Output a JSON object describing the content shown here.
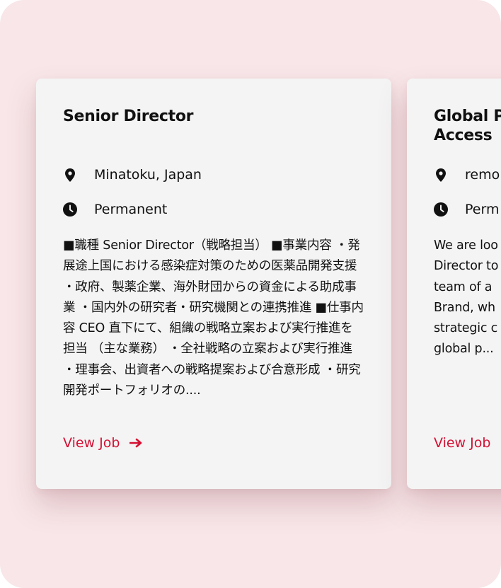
{
  "jobs": [
    {
      "title": "Senior Director",
      "location": "Minatoku, Japan",
      "type": "Permanent",
      "description": "■職種 Senior Director（戦略担当） ■事業内容 ・発展途上国における感染症対策のための医薬品開発支援 ・政府、製薬企業、海外財団からの資金による助成事業 ・国内外の研究者・研究機関との連携推進 ■仕事内容 CEO 直下にて、組織の戦略立案および実行推進を担当 （主な業務） ・全社戦略の立案および実行推進 ・理事会、出資者への戦略提案および合意形成 ・研究開発ポートフォリオの....",
      "link_label": "View Job"
    },
    {
      "title": "Global P\nAccess",
      "location": "remo",
      "type": "Perm",
      "description": "We are loo\nDirector to\nteam of a\nBrand, wh\nstrategic c\nglobal p...",
      "link_label": "View Job"
    }
  ],
  "colors": {
    "background": "#f8e6e8",
    "card": "#f4f4f4",
    "accent": "#d40f33",
    "text": "#111111"
  },
  "icons": {
    "location": "map-pin-icon",
    "type": "clock-icon",
    "link": "arrow-right-icon"
  }
}
